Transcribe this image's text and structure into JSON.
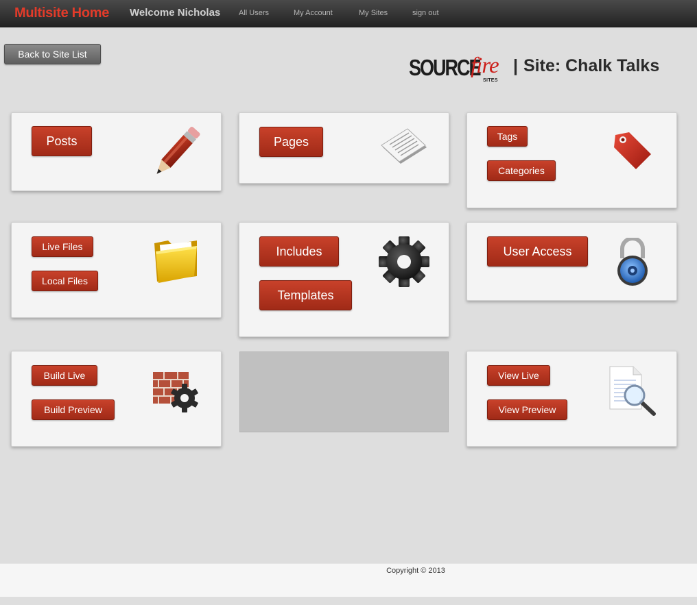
{
  "nav": {
    "brand": "Multisite Home",
    "welcome": "Welcome Nicholas",
    "links": [
      "All Users",
      "My Account",
      "My Sites",
      "sign out"
    ]
  },
  "toolbar": {
    "back_label": "Back to Site List"
  },
  "logo": {
    "source": "SOURCE",
    "fire": "fire",
    "sites": "SITES"
  },
  "site": {
    "separator": "|",
    "label": "Site: Chalk Talks"
  },
  "cards": {
    "posts": {
      "button": "Posts",
      "icon": "pencil-icon"
    },
    "pages": {
      "button": "Pages",
      "icon": "document-icon"
    },
    "tags": {
      "buttons": [
        "Tags",
        "Categories"
      ],
      "icon": "tag-icon"
    },
    "files": {
      "buttons": [
        "Live Files",
        "Local Files"
      ],
      "icon": "folder-icon"
    },
    "includes": {
      "buttons": [
        "Includes",
        "Templates"
      ],
      "icon": "gear-icon"
    },
    "access": {
      "button": "User Access",
      "icon": "padlock-icon"
    },
    "build": {
      "buttons": [
        "Build Live",
        "Build Preview"
      ],
      "icon": "brick-gear-icon"
    },
    "view": {
      "buttons": [
        "View Live",
        "View Preview"
      ],
      "icon": "document-magnifier-icon"
    }
  },
  "colors": {
    "accent": "#b5351f",
    "brand": "#e23b2a",
    "topbar": "#2e2e2e",
    "background": "#dedede"
  },
  "footer": {
    "copyright": "Copyright © 2013"
  }
}
